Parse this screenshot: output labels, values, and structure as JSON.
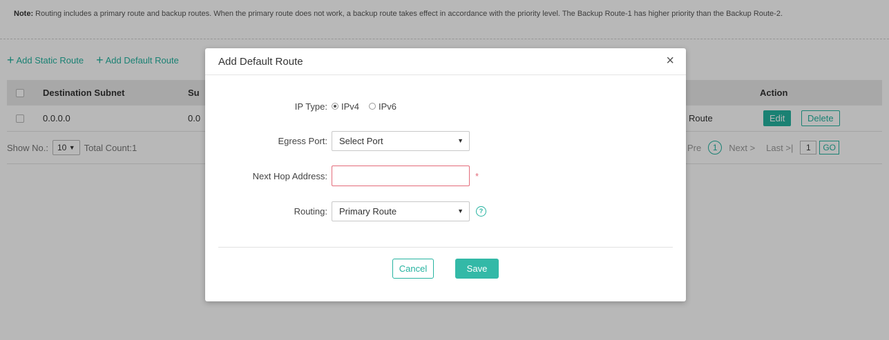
{
  "note": {
    "label": "Note:",
    "text": " Routing includes a primary route and backup routes. When the primary route does not work, a backup route takes effect in accordance with the priority level. The Backup Route-1 has higher priority than the Backup Route-2."
  },
  "toolbar": {
    "add_static": "Add Static Route",
    "add_default": "Add Default Route"
  },
  "table": {
    "columns": [
      "Destination Subnet",
      "Su",
      "Action"
    ],
    "rows": [
      {
        "destination": "0.0.0.0",
        "subnet": "0.0",
        "routing": "Route"
      }
    ],
    "edit_label": "Edit",
    "delete_label": "Delete"
  },
  "pager": {
    "show_label": "Show No.:",
    "page_size": "10",
    "total": "Total Count:1",
    "prev": "Pre",
    "current": "1",
    "next": "Next >",
    "last": "Last >|",
    "page_input": "1",
    "go": "GO"
  },
  "modal": {
    "title": "Add Default Route",
    "close": "×",
    "ip_type_label": "IP Type:",
    "ipv4": "IPv4",
    "ipv6": "IPv6",
    "egress_label": "Egress Port:",
    "egress_value": "Select Port",
    "nexthop_label": "Next Hop Address:",
    "nexthop_value": "",
    "required_mark": "*",
    "routing_label": "Routing:",
    "routing_value": "Primary Route",
    "help_icon": "?",
    "cancel": "Cancel",
    "save": "Save"
  },
  "colors": {
    "accent": "#25b3a0",
    "error": "#e36b7a"
  }
}
